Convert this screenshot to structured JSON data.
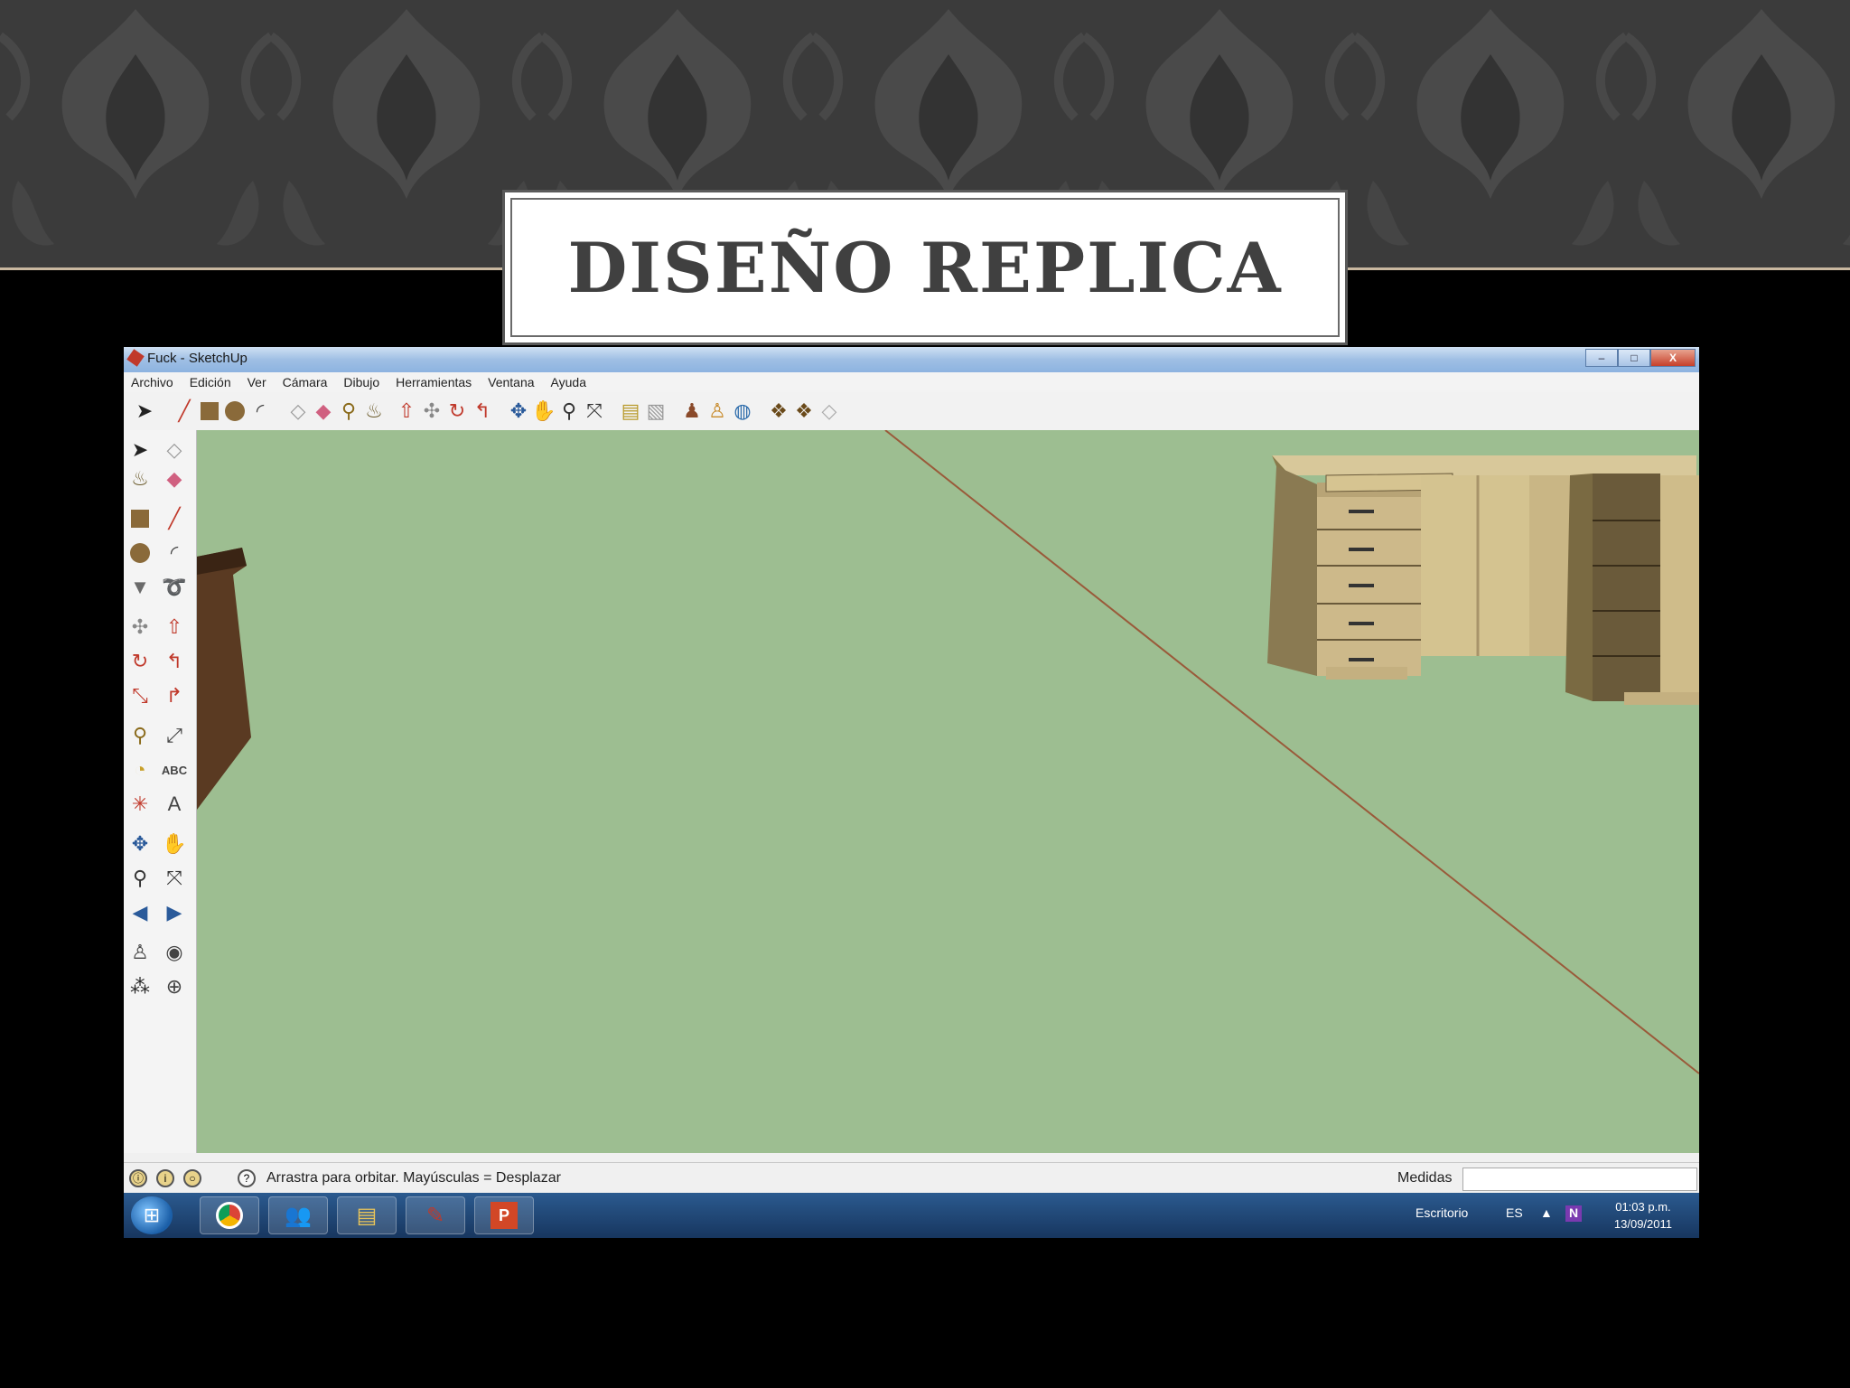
{
  "slide": {
    "title": "DISEÑO REPLICA"
  },
  "window": {
    "title": "Fuck - SketchUp",
    "minimize_icon": "minimize-icon",
    "maximize_icon": "maximize-icon",
    "close_label": "X"
  },
  "menu": {
    "items": [
      "Archivo",
      "Edición",
      "Ver",
      "Cámara",
      "Dibujo",
      "Herramientas",
      "Ventana",
      "Ayuda"
    ]
  },
  "toolbar": {
    "icons": [
      "select-icon",
      "pencil-icon",
      "rectangle-icon",
      "circle-icon",
      "arc-icon",
      "eraser-icon",
      "paint-bucket-icon",
      "tape-measure-icon",
      "push-pull-icon",
      "move-icon",
      "rotate-icon",
      "follow-me-icon",
      "orbit-icon",
      "pan-icon",
      "zoom-icon",
      "zoom-extents-icon",
      "layers-icon",
      "section-icon",
      "walk-icon",
      "warehouse-icon",
      "components-icon"
    ]
  },
  "sidebar": {
    "icons": [
      "select-icon",
      "component-icon",
      "paint-bucket-icon",
      "eraser-icon",
      "rectangle-icon",
      "line-icon",
      "circle-icon",
      "arc-icon",
      "polygon-icon",
      "freehand-icon",
      "move-icon",
      "push-pull-icon",
      "rotate-icon",
      "follow-me-icon",
      "scale-icon",
      "offset-icon",
      "tape-measure-icon",
      "dimension-icon",
      "protractor-icon",
      "text-icon",
      "axes-icon",
      "3d-text-icon",
      "orbit-icon",
      "pan-icon",
      "zoom-icon",
      "zoom-window-icon",
      "previous-view-icon",
      "next-view-icon",
      "position-camera-icon",
      "look-around-icon",
      "walk-icon",
      "section-plane-icon"
    ]
  },
  "status": {
    "hint": "Arrastra para orbitar. Mayúsculas = Desplazar",
    "measurements_label": "Medidas",
    "measurements_value": ""
  },
  "taskbar": {
    "desktop_label": "Escritorio",
    "language": "ES",
    "time": "01:03 p.m.",
    "date": "13/09/2011",
    "apps": [
      "chrome-icon",
      "users-icon",
      "folder-icon",
      "sketchup-icon",
      "powerpoint-icon"
    ]
  },
  "colors": {
    "viewport": "#9dbe91",
    "title_text": "#404040",
    "taskbar": "#1f4676"
  }
}
